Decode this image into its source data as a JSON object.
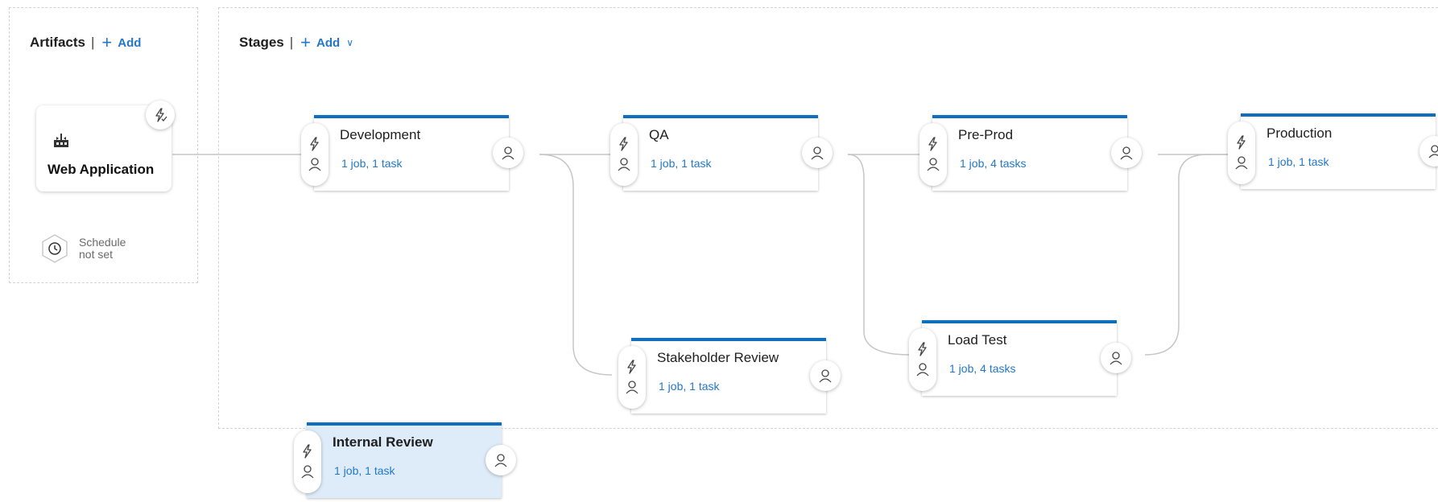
{
  "artifacts_panel": {
    "title": "Artifacts",
    "separator": "|",
    "add_label": "Add",
    "artifact": {
      "name": "Web Application",
      "icon": "build-icon"
    },
    "schedule": {
      "line1": "Schedule",
      "line2": "not set",
      "icon": "clock-icon"
    }
  },
  "stages_panel": {
    "title": "Stages",
    "separator": "|",
    "add_label": "Add"
  },
  "stages": [
    {
      "name": "Development",
      "jobs": "1 job, 1 task"
    },
    {
      "name": "QA",
      "jobs": "1 job, 1 task"
    },
    {
      "name": "Pre-Prod",
      "jobs": "1 job, 4 tasks"
    },
    {
      "name": "Production",
      "jobs": "1 job, 1 task"
    },
    {
      "name": "Stakeholder Review",
      "jobs": "1 job, 1 task"
    },
    {
      "name": "Load Test",
      "jobs": "1 job, 4 tasks"
    },
    {
      "name": "Internal Review",
      "jobs": "1 job, 1 task",
      "selected": true
    }
  ],
  "colors": {
    "accent": "#106ebe",
    "link": "#2277c9",
    "selected_bg": "#deecf9"
  }
}
